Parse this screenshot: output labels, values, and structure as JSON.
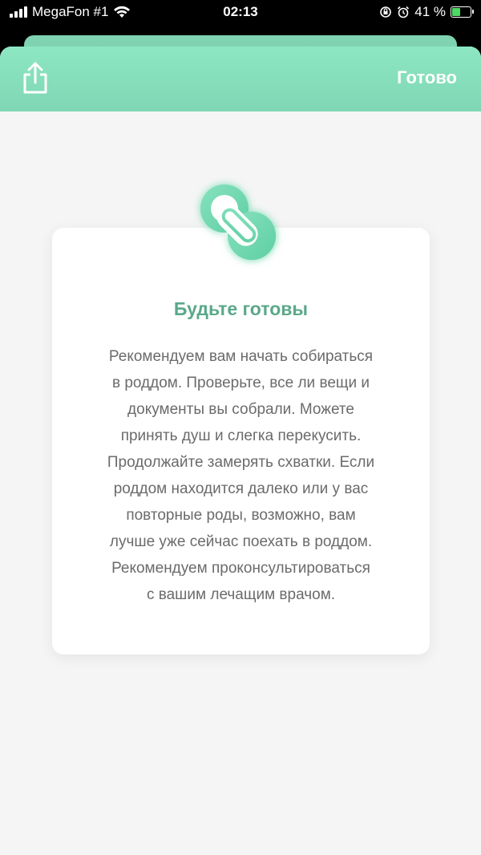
{
  "status_bar": {
    "carrier": "MegaFon #1",
    "time": "02:13",
    "battery_percent": "41 %",
    "battery_level": 0.41
  },
  "nav": {
    "done_label": "Готово"
  },
  "card": {
    "title": "Будьте готовы",
    "lines": [
      "Рекомендуем вам начать собираться",
      "в роддом. Проверьте, все ли вещи и",
      "документы вы собрали. Можете",
      "принять душ и слегка перекусить.",
      "Продолжайте замерять схватки. Если",
      "роддом находится далеко или у вас",
      "повторные роды, возможно, вам",
      "лучше уже сейчас поехать в роддом.",
      "Рекомендуем проконсультироваться",
      "с вашим лечащим врачом."
    ]
  },
  "colors": {
    "accent": "#7fd6b5",
    "title": "#5aa88a"
  }
}
